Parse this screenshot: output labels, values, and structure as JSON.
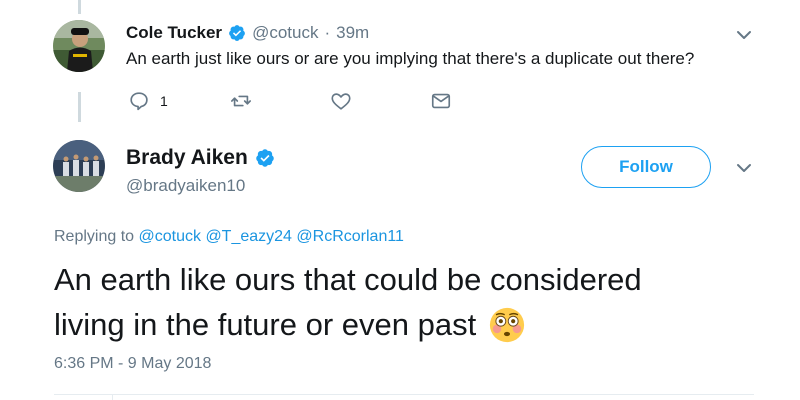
{
  "reply_tweet": {
    "author_name": "Cole Tucker",
    "handle": "@cotuck",
    "separator": "·",
    "time": "39m",
    "text": "An earth just like ours or are you implying that there's a duplicate out there?",
    "reply_count": "1",
    "icons": [
      "reply-icon",
      "retweet-icon",
      "like-icon",
      "dm-icon",
      "chevron-down-icon",
      "verified-badge-icon"
    ]
  },
  "main_tweet": {
    "author_name": "Brady Aiken",
    "handle": "@bradyaiken10",
    "follow_label": "Follow",
    "replying_prefix": "Replying to",
    "replying_to": [
      "@cotuck",
      "@T_eazy24",
      "@RcRcorlan11"
    ],
    "text_line1": "An earth like ours that could be considered",
    "text_line2": "living in the future or even past",
    "emoji": "flushed-face-emoji",
    "timestamp": "6:36 PM - 9 May 2018"
  },
  "colors": {
    "brand_blue": "#1da1f2",
    "mention_blue": "#1b95e0",
    "secondary_text": "#657786",
    "primary_text": "#14171a",
    "icon_gray": "#657786",
    "thread_line": "#cfd9de"
  }
}
